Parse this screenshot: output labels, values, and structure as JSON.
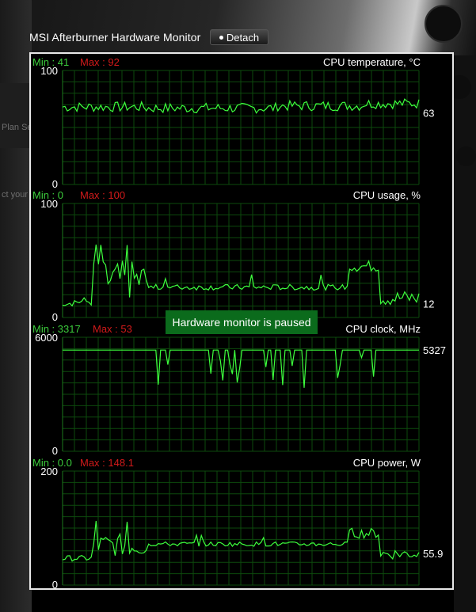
{
  "window": {
    "title": "MSI Afterburner Hardware Monitor",
    "detach_label": "Detach",
    "paused_message": "Hardware monitor is paused"
  },
  "background": {
    "partial_text_1": "Plan Settings",
    "partial_text_2": "ct your comp"
  },
  "colors": {
    "line": "#3dff3d",
    "grid": "#0d4a0d",
    "max": "#d21a1a",
    "min": "#3ccd3c",
    "paused_bg": "#0b6b1c"
  },
  "panels": [
    {
      "id": "cpu-temp",
      "title": "CPU temperature, °C",
      "min_label": "Min : 41",
      "max_label": "Max : 92",
      "y_top": "100",
      "y_bottom": "0",
      "current": "63",
      "ymax": 100
    },
    {
      "id": "cpu-usage",
      "title": "CPU usage, %",
      "min_label": "Min : 0",
      "max_label": "Max : 100",
      "y_top": "100",
      "y_bottom": "0",
      "current": "12",
      "ymax": 100
    },
    {
      "id": "cpu-clock",
      "title": "CPU clock, MHz",
      "min_label": "Min : 3317",
      "max_label": "Max : 53",
      "y_top": "6000",
      "y_bottom": "0",
      "current": "5327",
      "ymax": 6000
    },
    {
      "id": "cpu-power",
      "title": "CPU power, W",
      "min_label": "Min : 0.0",
      "max_label": "Max : 148.1",
      "y_top": "200",
      "y_bottom": "0",
      "current": "55.9",
      "ymax": 200
    }
  ]
}
